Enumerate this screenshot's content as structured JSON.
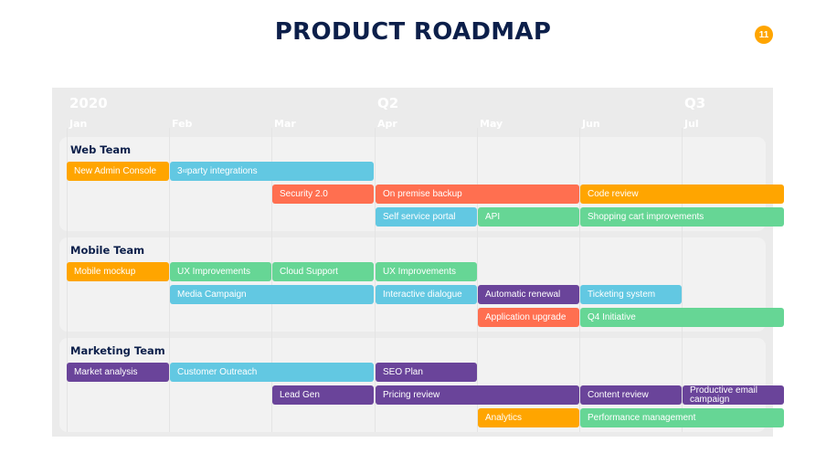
{
  "title": "PRODUCT ROADMAP",
  "page_number": "11",
  "colors": {
    "orange": "#ffa500",
    "blue": "#62c8e2",
    "coral": "#ff6f50",
    "green": "#66d695",
    "purple": "#6a449a",
    "navy": "#0c1f4a"
  },
  "timeline": {
    "periods": [
      {
        "label": "2020",
        "month_index": 0
      },
      {
        "label": "Q2",
        "month_index": 3
      },
      {
        "label": "Q3",
        "month_index": 6
      }
    ],
    "months": [
      "Jan",
      "Feb",
      "Mar",
      "Apr",
      "May",
      "Jun",
      "Jul"
    ]
  },
  "teams": [
    {
      "name": "Web Team",
      "tasks": [
        {
          "label": "New Admin Console",
          "start": 0,
          "end": 1,
          "row": 0,
          "color": "orange"
        },
        {
          "label": "3rd party integrations",
          "start": 1,
          "end": 3,
          "row": 0,
          "color": "blue"
        },
        {
          "label": "Security 2.0",
          "start": 2,
          "end": 3,
          "row": 1,
          "color": "coral"
        },
        {
          "label": "On premise backup",
          "start": 3,
          "end": 5,
          "row": 1,
          "color": "coral"
        },
        {
          "label": "Code review",
          "start": 5,
          "end": 7,
          "row": 1,
          "color": "orange"
        },
        {
          "label": "Self service portal",
          "start": 3,
          "end": 4,
          "row": 2,
          "color": "blue"
        },
        {
          "label": "API",
          "start": 4,
          "end": 5,
          "row": 2,
          "color": "green"
        },
        {
          "label": "Shopping cart improvements",
          "start": 5,
          "end": 7,
          "row": 2,
          "color": "green"
        }
      ]
    },
    {
      "name": "Mobile Team",
      "tasks": [
        {
          "label": "Mobile mockup",
          "start": 0,
          "end": 1,
          "row": 0,
          "color": "orange"
        },
        {
          "label": "UX Improvements",
          "start": 1,
          "end": 2,
          "row": 0,
          "color": "green"
        },
        {
          "label": "Cloud Support",
          "start": 2,
          "end": 3,
          "row": 0,
          "color": "green"
        },
        {
          "label": "UX Improvements",
          "start": 3,
          "end": 4,
          "row": 0,
          "color": "green"
        },
        {
          "label": "Media Campaign",
          "start": 1,
          "end": 3,
          "row": 1,
          "color": "blue"
        },
        {
          "label": "Interactive dialogue",
          "start": 3,
          "end": 4,
          "row": 1,
          "color": "blue"
        },
        {
          "label": "Automatic renewal",
          "start": 4,
          "end": 5,
          "row": 1,
          "color": "purple"
        },
        {
          "label": "Ticketing system",
          "start": 5,
          "end": 6,
          "row": 1,
          "color": "blue"
        },
        {
          "label": "Application upgrade",
          "start": 4,
          "end": 5,
          "row": 2,
          "color": "coral"
        },
        {
          "label": "Q4 Initiative",
          "start": 5,
          "end": 7,
          "row": 2,
          "color": "green"
        }
      ]
    },
    {
      "name": "Marketing Team",
      "tasks": [
        {
          "label": "Market analysis",
          "start": 0,
          "end": 1,
          "row": 0,
          "color": "purple"
        },
        {
          "label": "Customer Outreach",
          "start": 1,
          "end": 3,
          "row": 0,
          "color": "blue"
        },
        {
          "label": "SEO Plan",
          "start": 3,
          "end": 4,
          "row": 0,
          "color": "purple"
        },
        {
          "label": "Lead Gen",
          "start": 2,
          "end": 3,
          "row": 1,
          "color": "purple"
        },
        {
          "label": "Pricing review",
          "start": 3,
          "end": 5,
          "row": 1,
          "color": "purple"
        },
        {
          "label": "Content review",
          "start": 5,
          "end": 6,
          "row": 1,
          "color": "purple"
        },
        {
          "label": "Productive email campaign",
          "start": 6,
          "end": 7,
          "row": 1,
          "color": "purple"
        },
        {
          "label": "Analytics",
          "start": 4,
          "end": 5,
          "row": 2,
          "color": "orange"
        },
        {
          "label": "Performance management",
          "start": 5,
          "end": 7,
          "row": 2,
          "color": "green"
        }
      ]
    }
  ]
}
